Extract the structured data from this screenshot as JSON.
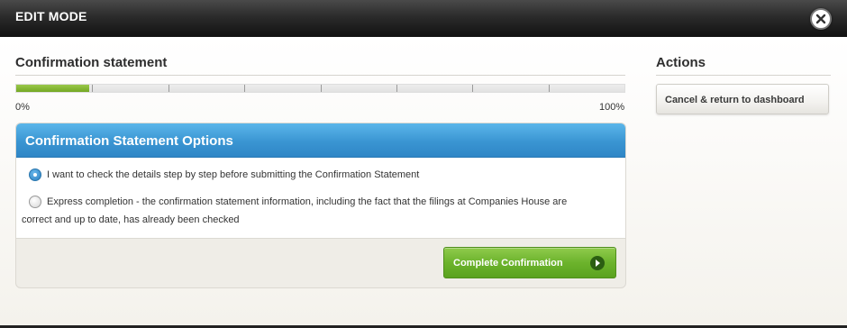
{
  "modal": {
    "title": "EDIT MODE"
  },
  "confirmation": {
    "title": "Confirmation statement",
    "progress": {
      "value_percent": 12,
      "start_label": "0%",
      "end_label": "100%",
      "segments": 8
    }
  },
  "options": {
    "header": "Confirmation Statement Options",
    "items": [
      {
        "text": "I want to check the details step by step before submitting the Confirmation Statement",
        "selected": true
      },
      {
        "line1": "Express completion - the confirmation statement information, including the fact that the filings at Companies House are",
        "line2": "correct and up to date, has already been checked",
        "selected": false
      }
    ],
    "complete_button": "Complete Confirmation"
  },
  "actions": {
    "title": "Actions",
    "cancel_button": "Cancel & return to dashboard"
  },
  "colors": {
    "progress_fill": "#7cb22e",
    "header_blue": "#3a95d2",
    "complete_green": "#6cb32c"
  },
  "icons": {
    "close": "close-icon",
    "arrow": "chevron-right-icon"
  }
}
